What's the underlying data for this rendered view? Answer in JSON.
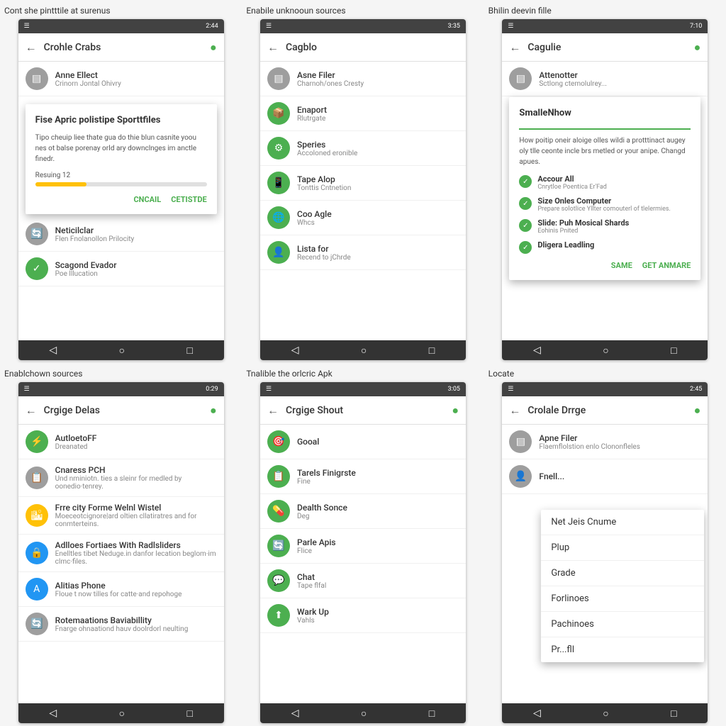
{
  "cells": [
    {
      "id": "cell-1",
      "title": "Cont she pintttile at surenus",
      "statusTime": "2:44",
      "topBarTitle": "Crohle Crabs",
      "listItems": [
        {
          "icon": "gray",
          "iconChar": "▤",
          "title": "Anne Ellect",
          "sub": "Crinorn Jontal Ohivry"
        }
      ],
      "dialog": {
        "title": "Fise Apric polistipe Sporttfiles",
        "body": "Tipo cheuip liee thate gua do thie blun casnite yoou nes ot balse porenay orId ary downclnges im anctle finedr.",
        "progressLabel": "Resuing",
        "progressValue": "12",
        "buttons": [
          "CNCAIL",
          "CETISTDE"
        ]
      },
      "moreItems": [
        {
          "icon": "gray",
          "iconChar": "🔄",
          "title": "Neticilclar",
          "sub": "Flen Fnolanollon Prilocity"
        },
        {
          "icon": "green",
          "iconChar": "✓",
          "title": "Scagond Evador",
          "sub": "Poe lllucation"
        }
      ]
    },
    {
      "id": "cell-2",
      "title": "Enabile unknooun sources",
      "statusTime": "3:35",
      "topBarTitle": "Cagblo",
      "listItems": [
        {
          "icon": "gray",
          "iconChar": "▤",
          "title": "Asne Filer",
          "sub": "Charnoh/ones Cresty"
        },
        {
          "icon": "green",
          "iconChar": "📦",
          "title": "Enaport",
          "sub": "Rlutrgate"
        },
        {
          "icon": "green",
          "iconChar": "⚙",
          "title": "Speries",
          "sub": "Accoloned eronible"
        },
        {
          "icon": "green",
          "iconChar": "📱",
          "title": "Tape Alop",
          "sub": "Tonttis Cntnetion"
        },
        {
          "icon": "green",
          "iconChar": "🌐",
          "title": "Coo Agle",
          "sub": "Whcs"
        },
        {
          "icon": "green",
          "iconChar": "👤",
          "title": "Lista for",
          "sub": "Recend to jChrde"
        }
      ]
    },
    {
      "id": "cell-3",
      "title": "Bhilin deevin fille",
      "statusTime": "7:10",
      "topBarTitle": "Cagulie",
      "listItems": [
        {
          "icon": "gray",
          "iconChar": "▤",
          "title": "Attenotter",
          "sub": "Sctlong ctemolulrey..."
        }
      ],
      "dialog2": {
        "title": "SmalleNhow",
        "body": "How poitip oneir aloige olles wildi a protttinact augey oly tlle ceonte incle brs metled or your anipe. Changd apues.",
        "checks": [
          {
            "title": "Accour All",
            "sub": "Cnrytloe Poentica Er'Fad"
          },
          {
            "title": "Size Onles Computer",
            "sub": "Prepare solotlice Yllter comouterl of tlelermies."
          },
          {
            "title": "Slide: Puh Mosical Shards",
            "sub": "Eohinis Pnited"
          },
          {
            "title": "Dligera Leadling",
            "sub": ""
          }
        ],
        "buttons": [
          "SAME",
          "GET ANMARE"
        ]
      }
    },
    {
      "id": "cell-4",
      "title": "Enablchown sources",
      "statusTime": "0:29",
      "topBarTitle": "Crgige Delas",
      "listItems": [
        {
          "icon": "green",
          "iconChar": "⚡",
          "title": "AutloetoFF",
          "sub": "Dreanated"
        },
        {
          "icon": "gray",
          "iconChar": "📋",
          "title": "Cnaress PCH",
          "sub": "Und nminiotn. ties a sleinr for medled by oonedio·tenrey."
        },
        {
          "icon": "yellow",
          "iconChar": "🏙",
          "title": "Frre city Forme Welnl Wistel",
          "sub": "Moeceotcignore|ard oltien cllatiratres and for conmterteins."
        },
        {
          "icon": "blue",
          "iconChar": "🔒",
          "title": "Adlloes Fortiaes With Radlsliders",
          "sub": "Enelltles tibet Neduge.in danfor Iecation beglom·im clmc·files."
        },
        {
          "icon": "blue",
          "iconChar": "A",
          "title": "Alitias Phone",
          "sub": "Floue t now tilles for catte·and repohoge"
        },
        {
          "icon": "gray",
          "iconChar": "🔄",
          "title": "Rotemaations Baviabillity",
          "sub": "Fnarge ohnaationd hauv doolrdorl neulting"
        }
      ]
    },
    {
      "id": "cell-5",
      "title": "Tnalible the orlcric Apk",
      "statusTime": "3:05",
      "topBarTitle": "Crgige Shout",
      "listItems": [
        {
          "icon": "green",
          "iconChar": "🎯",
          "title": "Gooal",
          "sub": ""
        },
        {
          "icon": "green",
          "iconChar": "📋",
          "title": "Tarels Finigrste",
          "sub": "Fine"
        },
        {
          "icon": "green",
          "iconChar": "💊",
          "title": "Dealth Sonce",
          "sub": "Deg"
        },
        {
          "icon": "green",
          "iconChar": "🔄",
          "title": "Parle Apis",
          "sub": "Flice"
        },
        {
          "icon": "green",
          "iconChar": "💬",
          "title": "Chat",
          "sub": "Tape flfal"
        },
        {
          "icon": "green",
          "iconChar": "⬆",
          "title": "Wark Up",
          "sub": "Vahls"
        }
      ]
    },
    {
      "id": "cell-6",
      "title": "Locate",
      "statusTime": "2:45",
      "topBarTitle": "Crolale Drrge",
      "listItems": [
        {
          "icon": "gray",
          "iconChar": "▤",
          "title": "Apne Filer",
          "sub": "Flaemflolstion enlo Clononfleles"
        }
      ],
      "dropdown": {
        "items": [
          "Net Jeis Cnume",
          "Plup",
          "Grade",
          "Forlinoes",
          "Pachinoes",
          "Pr...fll"
        ]
      }
    }
  ],
  "navBar": {
    "back": "◁",
    "home": "○",
    "recent": "□"
  }
}
